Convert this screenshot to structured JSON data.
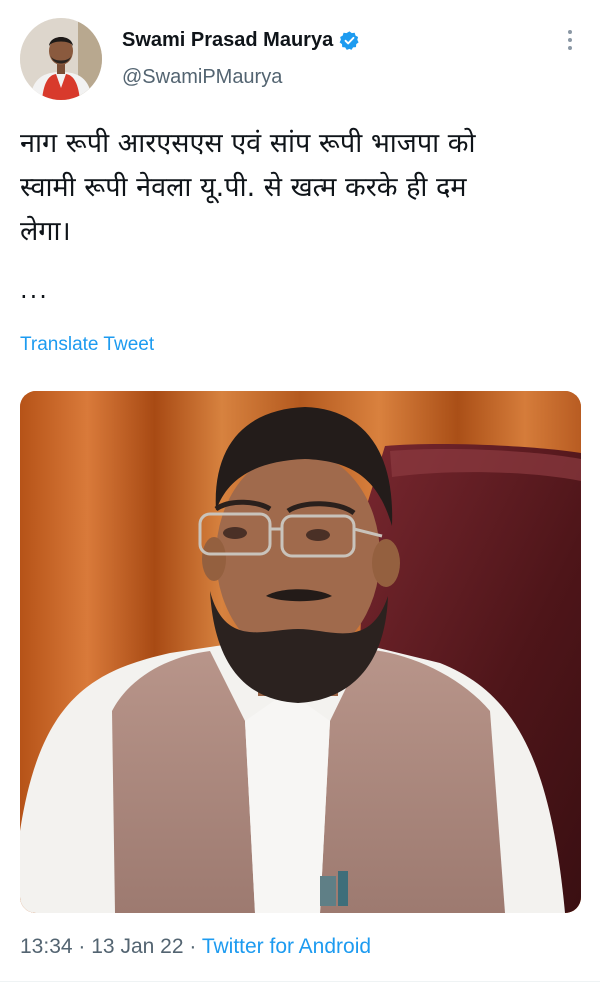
{
  "author": {
    "display_name": "Swami Prasad Maurya",
    "handle": "@SwamiPMaurya",
    "verified": true,
    "verified_color": "#1d9bf0"
  },
  "tweet": {
    "text_line1": "नाग रूपी आरएसएस एवं सांप रूपी भाजपा को",
    "text_line2": "स्वामी रूपी नेवला यू.पी. से खत्म करके ही दम",
    "text_line3": "लेगा।",
    "ellipsis": "...",
    "translate_label": "Translate Tweet",
    "time": "13:34",
    "date": "13 Jan 22",
    "separator": "·",
    "source": "Twitter for Android"
  },
  "icons": {
    "more": "more-options-icon",
    "verified": "verified-badge-icon"
  },
  "colors": {
    "link": "#1d9bf0",
    "secondary_text": "#536471",
    "primary_text": "#0f1419"
  }
}
